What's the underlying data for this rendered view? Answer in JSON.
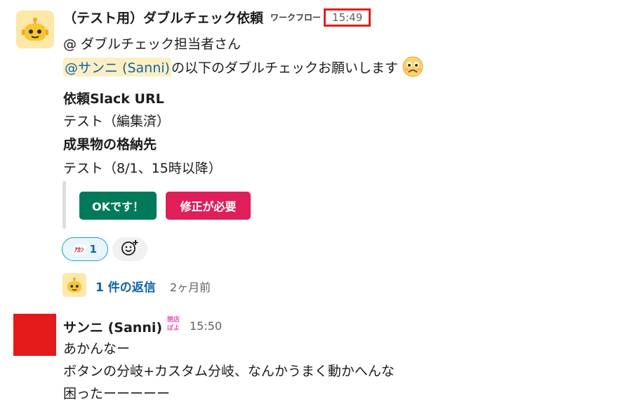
{
  "message1": {
    "sender": "（テスト用）ダブルチェック依頼",
    "app_badge": "ワークフロー",
    "timestamp": "15:49",
    "greeting": "@ ダブルチェック担当者さん",
    "mention": "@サンニ (Sanni)",
    "request_text": "の以下のダブルチェックお願いします",
    "label_url": "依頼Slack URL",
    "value_url": "テスト（編集済）",
    "label_location": "成果物の格納先",
    "value_location": "テスト（8/1、15時以降）",
    "button_ok": "OKです！",
    "button_fix": "修正が必要",
    "reaction_emoji": "ｱｶﾝ",
    "reaction_count": "1",
    "thread_replies": "1 件の返信",
    "thread_time": "2ヶ月前"
  },
  "message2": {
    "sender": "サンニ (Sanni)",
    "status_emoji_text": "閉店ぽよ",
    "timestamp": "15:50",
    "lines": [
      "あかんなー",
      "ボタンの分岐+カスタム分岐、なんかうまく動かへんな",
      "困ったーーーーー"
    ]
  },
  "colors": {
    "link": "#1264a3",
    "ok_button": "#007a5a",
    "fix_button": "#e01e5a",
    "highlight": "#e01e20",
    "mention_bg": "#fcefc4"
  },
  "icons": [
    "robot-avatar-icon",
    "pleading-face-icon",
    "add-reaction-icon"
  ]
}
